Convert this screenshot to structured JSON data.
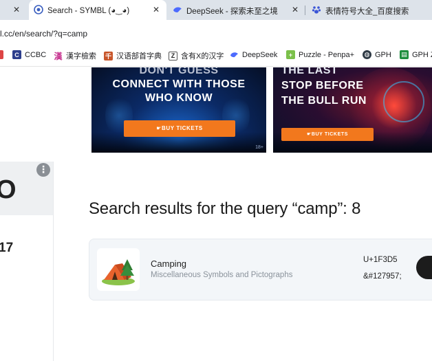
{
  "tabs": [
    {
      "close": "✕",
      "title": ""
    },
    {
      "title": "Search - SYMBL (◕‿◕)",
      "close": "✕",
      "active": true,
      "icon": "symbl-icon"
    },
    {
      "title": "DeepSeek - 探索未至之境",
      "close": "✕",
      "icon": "deepseek-whale-icon"
    },
    {
      "title": "表情符号大全_百度搜索",
      "close": "✕",
      "icon": "baidu-paw-icon"
    }
  ],
  "address": {
    "url": "l.cc/en/search/?q=camp"
  },
  "bookmarks": [
    {
      "label": "",
      "icon": "bookmark-partial-icon"
    },
    {
      "label": "CCBC",
      "icon": "ccbc-icon"
    },
    {
      "label": "漢字檢索",
      "icon": "han-search-icon"
    },
    {
      "label": "汉语部首字典",
      "icon": "radical-dict-icon"
    },
    {
      "label": "含有X的汉字",
      "icon": "zi-icon"
    },
    {
      "label": "DeepSeek",
      "icon": "deepseek-whale-icon"
    },
    {
      "label": "Puzzle - Penpa+",
      "icon": "puzzle-icon"
    },
    {
      "label": "GPH",
      "icon": "globe-icon"
    },
    {
      "label": "GPH Z",
      "icon": "gph-sheet-icon"
    }
  ],
  "ads": [
    {
      "lines": [
        "DON'T GUESS",
        "CONNECT WITH THOSE",
        "WHO KNOW"
      ],
      "button": "BUY TICKETS",
      "tag": "18+"
    },
    {
      "lines": [
        "THE LAST",
        "STOP BEFORE",
        "THE BULL RUN"
      ],
      "button": "BUY TICKETS"
    }
  ],
  "sidebar": {
    "letter": "O",
    "number": "17",
    "menu": "⋮"
  },
  "results": {
    "heading": "Search results for the query “camp”: 8",
    "items": [
      {
        "emoji": "🏕",
        "name": "Camping",
        "block": "Miscellaneous Symbols and Pictographs",
        "code": "U+1F3D5",
        "html": "&#127957;"
      }
    ]
  },
  "colors": {
    "tabstrip": "#dde3ea",
    "ad_button": "#f2781d",
    "card_bg": "#f3f6f9"
  }
}
